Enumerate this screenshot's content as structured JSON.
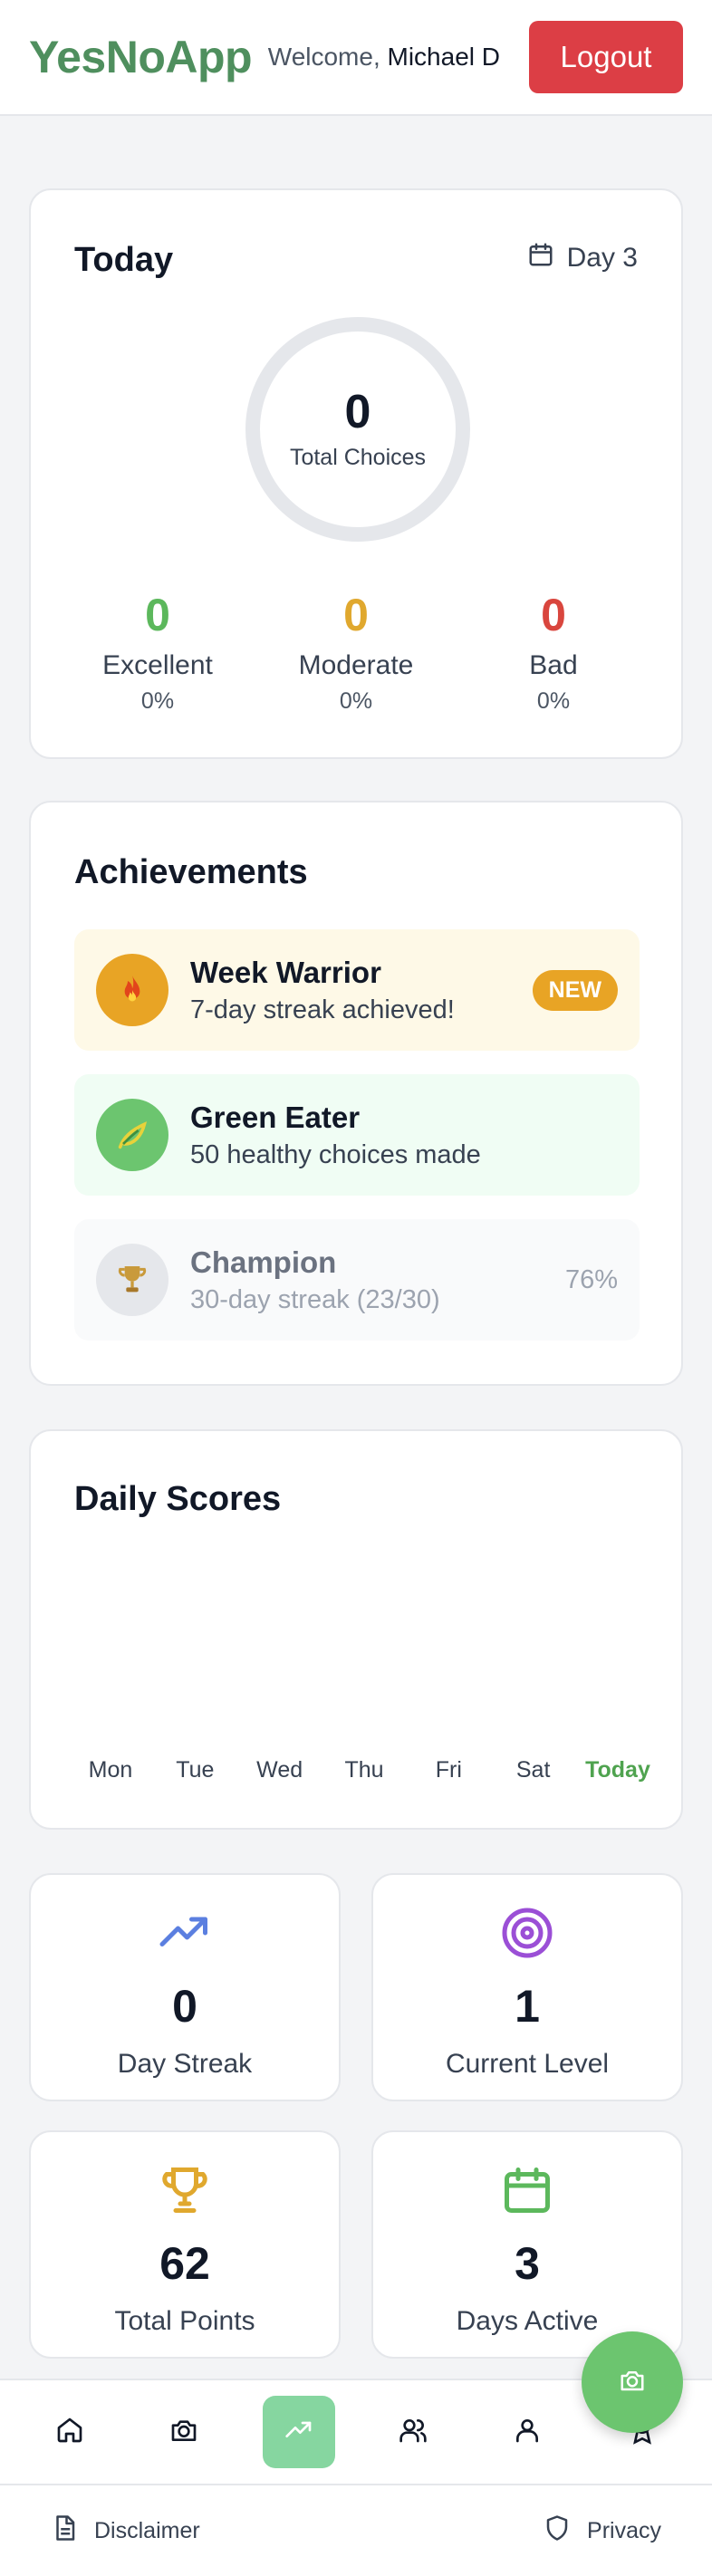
{
  "header": {
    "logo": "YesNoApp",
    "welcome_prefix": "Welcome,",
    "user_name": "Michael D",
    "logout_label": "Logout"
  },
  "today": {
    "title": "Today",
    "day_label": "Day 3",
    "total_choices": "0",
    "total_choices_label": "Total Choices",
    "stats": [
      {
        "value": "0",
        "label": "Excellent",
        "percent": "0%",
        "color": "#5cb85c"
      },
      {
        "value": "0",
        "label": "Moderate",
        "percent": "0%",
        "color": "#e0a82e"
      },
      {
        "value": "0",
        "label": "Bad",
        "percent": "0%",
        "color": "#d9463e"
      }
    ]
  },
  "achievements": {
    "title": "Achievements",
    "items": [
      {
        "name": "Week Warrior",
        "desc": "7-day streak achieved!",
        "badge": "NEW",
        "icon": "fire-icon"
      },
      {
        "name": "Green Eater",
        "desc": "50 healthy choices made",
        "icon": "leaf-icon"
      },
      {
        "name": "Champion",
        "desc": "30-day streak (23/30)",
        "progress": "76%",
        "icon": "trophy-icon"
      }
    ]
  },
  "daily_scores": {
    "title": "Daily Scores",
    "days": [
      "Mon",
      "Tue",
      "Wed",
      "Thu",
      "Fri",
      "Sat",
      "Today"
    ]
  },
  "tiles": [
    {
      "value": "0",
      "label": "Day Streak",
      "icon": "trending-up-icon",
      "color": "#5b7fe0"
    },
    {
      "value": "1",
      "label": "Current Level",
      "icon": "target-icon",
      "color": "#9b4fd6"
    },
    {
      "value": "62",
      "label": "Total Points",
      "icon": "trophy-icon",
      "color": "#e0a82e"
    },
    {
      "value": "3",
      "label": "Days Active",
      "icon": "calendar-icon",
      "color": "#5cb85c"
    }
  ],
  "footer": {
    "disclaimer": "Disclaimer",
    "privacy": "Privacy"
  }
}
